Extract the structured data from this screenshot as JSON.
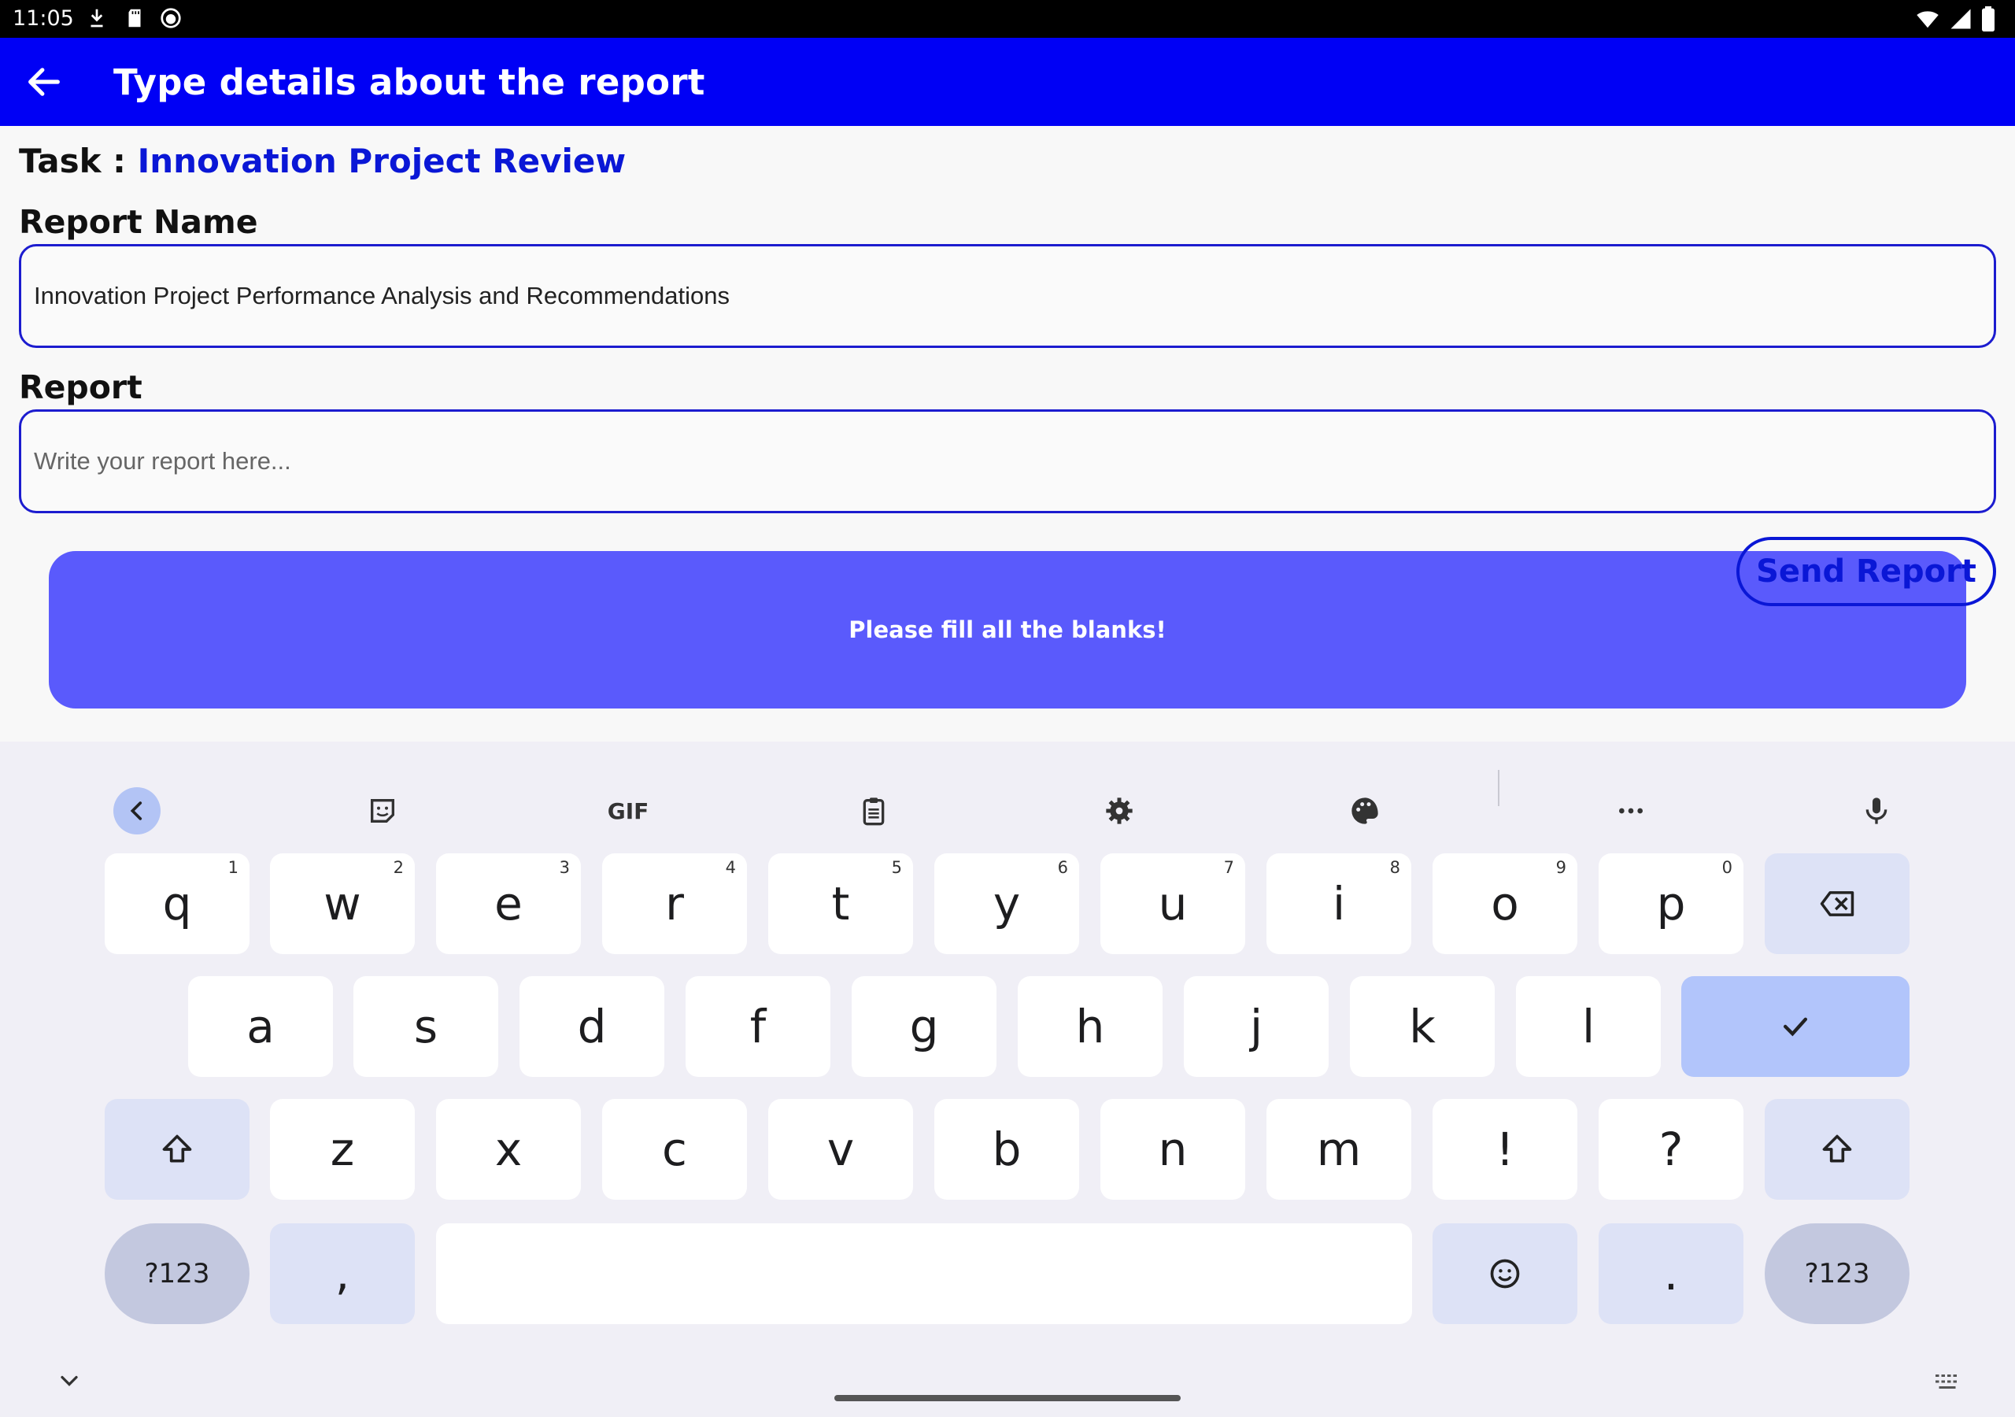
{
  "status_bar": {
    "time": "11:05",
    "left_icons": [
      "download-icon",
      "sd-card-icon",
      "face-icon"
    ],
    "right_icons": [
      "wifi-icon",
      "signal-icon",
      "battery-icon"
    ]
  },
  "app_bar": {
    "back_icon": "arrow-back-icon",
    "title": "Type details about the report",
    "color": "#0000f5"
  },
  "task": {
    "prefix": "Task : ",
    "name": "Innovation Project Review"
  },
  "report_name": {
    "label": "Report Name",
    "value": "Innovation Project Performance Analysis and Recommendations"
  },
  "report": {
    "label": "Report",
    "placeholder": "Write your report here..."
  },
  "send_button": {
    "label": "Send Report"
  },
  "snackbar": {
    "message": "Please fill all the blanks!"
  },
  "keyboard": {
    "toolbar": [
      "chevron-left-icon",
      "sticker-icon",
      "gif-icon",
      "clipboard-icon",
      "settings-gear-icon",
      "palette-icon",
      "more-dots-icon",
      "microphone-icon"
    ],
    "gif_label": "GIF",
    "row1": [
      {
        "char": "q",
        "hint": "1"
      },
      {
        "char": "w",
        "hint": "2"
      },
      {
        "char": "e",
        "hint": "3"
      },
      {
        "char": "r",
        "hint": "4"
      },
      {
        "char": "t",
        "hint": "5"
      },
      {
        "char": "y",
        "hint": "6"
      },
      {
        "char": "u",
        "hint": "7"
      },
      {
        "char": "i",
        "hint": "8"
      },
      {
        "char": "o",
        "hint": "9"
      },
      {
        "char": "p",
        "hint": "0"
      }
    ],
    "row2": [
      "a",
      "s",
      "d",
      "f",
      "g",
      "h",
      "j",
      "k",
      "l"
    ],
    "row3": [
      "z",
      "x",
      "c",
      "v",
      "b",
      "n",
      "m",
      "!",
      "?"
    ],
    "symbols_label": "?123",
    "comma": ",",
    "period": "."
  }
}
